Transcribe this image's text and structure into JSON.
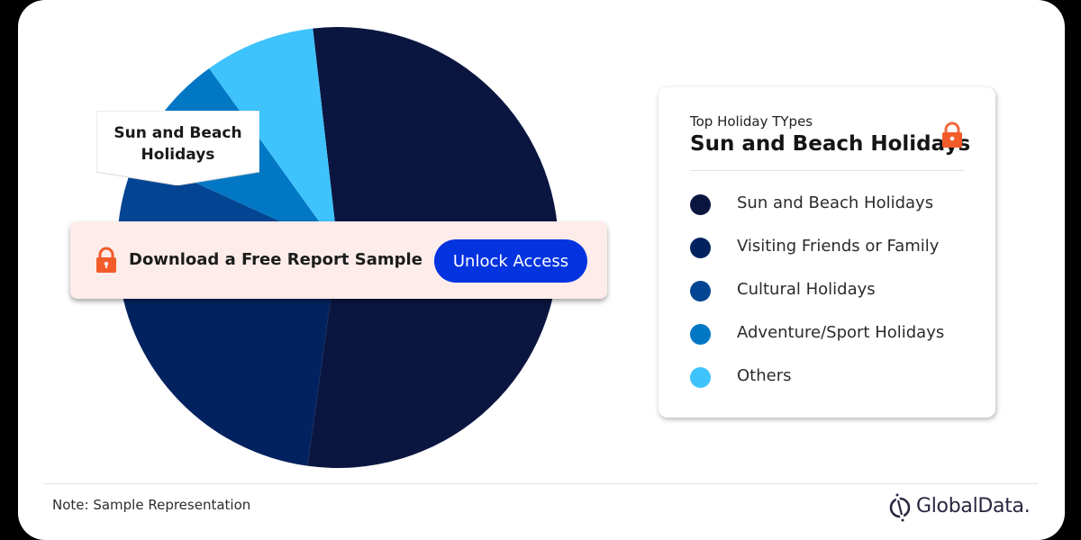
{
  "chart_data": {
    "type": "pie",
    "title": "Top Holiday TYpes",
    "highlighted": "Sun and Beach Holidays",
    "categories": [
      "Sun and Beach Holidays",
      "Visiting Friends or Family",
      "Cultural Holidays",
      "Adventure/Sport Holidays",
      "Others"
    ],
    "values": [
      54,
      21,
      8.6,
      8.3,
      8.1
    ],
    "unit": "percent (estimated, sample representation)",
    "colors": [
      "#0b1640",
      "#02225f",
      "#034592",
      "#0277c4",
      "#3ec3fc"
    ],
    "start_angle_deg": -6.5,
    "direction": "clockwise",
    "legend": "right"
  },
  "callout": {
    "line1": "Sun and Beach",
    "line2": "Holidays"
  },
  "banner": {
    "text": "Download a Free Report Sample",
    "button_label": "Unlock Access",
    "accent": "#0433e0",
    "lock_color": "#f25b2a"
  },
  "legend_panel": {
    "subtitle": "Top Holiday TYpes",
    "title": "Sun and Beach Holidays",
    "items": [
      {
        "label": "Sun and Beach Holidays",
        "color": "#0b1640"
      },
      {
        "label": "Visiting Friends or Family",
        "color": "#02225f"
      },
      {
        "label": "Cultural Holidays",
        "color": "#034592"
      },
      {
        "label": "Adventure/Sport Holidays",
        "color": "#0277c4"
      },
      {
        "label": "Others",
        "color": "#3ec3fc"
      }
    ]
  },
  "footer": {
    "note": "Note: Sample Representation",
    "brand": "GlobalData."
  }
}
